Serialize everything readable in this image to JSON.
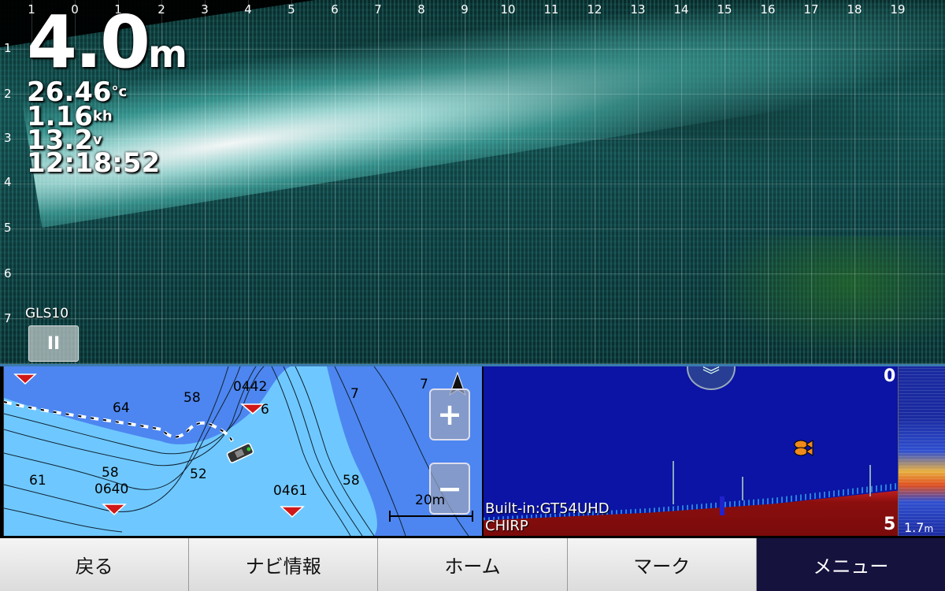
{
  "livescope": {
    "x_ticks": [
      "1",
      "0",
      "1",
      "2",
      "3",
      "4",
      "5",
      "6",
      "7",
      "8",
      "9",
      "10",
      "11",
      "12",
      "13",
      "14",
      "15",
      "16",
      "17",
      "18",
      "19"
    ],
    "y_ticks": [
      "1",
      "2",
      "3",
      "4",
      "5",
      "6",
      "7"
    ],
    "depth_value": "4.0",
    "depth_unit": "m",
    "water_temp": "26.46",
    "water_temp_unit": "°c",
    "speed": "1.16",
    "speed_unit": "kh",
    "voltage": "13.2",
    "voltage_unit": "v",
    "time": "12:18:52",
    "transducer": "GLS10",
    "pause_icon": "pause-icon",
    "pause_label": "II"
  },
  "map": {
    "waypoints": [
      {
        "name": "0442"
      },
      {
        "name": "0640"
      },
      {
        "name": "0461"
      }
    ],
    "contour_labels": [
      "64",
      "58",
      "6",
      "7",
      "61",
      "58",
      "52",
      "58",
      "7"
    ],
    "zoom_in_label": "+",
    "zoom_out_label": "−",
    "scale_label": "20m",
    "north_icon": "north-arrow-icon",
    "colors": {
      "deep": "#4d86f0",
      "shallow": "#6ec8ff",
      "track": "#ffffff"
    }
  },
  "sonar": {
    "transducer_label": "Built-in:GT54UHD",
    "mode_label": "CHIRP",
    "top_range": "0",
    "bottom_range": "5",
    "amode_reading": "1.7",
    "amode_unit": "m",
    "fish_icon": "fish-icon",
    "collapse_icon": "chevron-down-icon"
  },
  "nav": {
    "back": "戻る",
    "nav_info": "ナビ情報",
    "home": "ホーム",
    "mark": "マーク",
    "menu": "メニュー"
  }
}
